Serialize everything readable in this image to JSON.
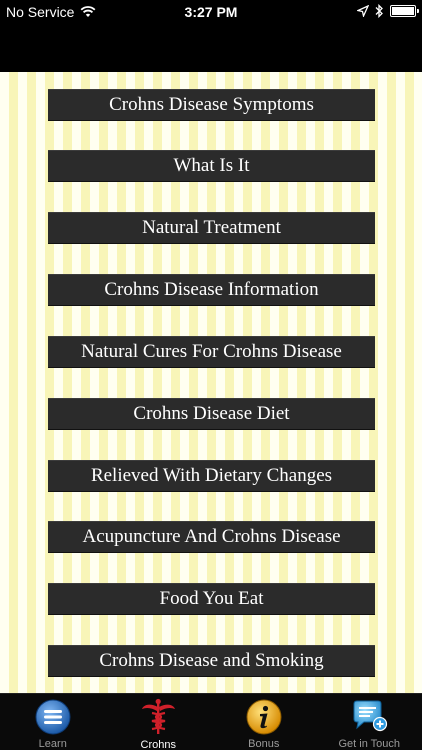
{
  "status_bar": {
    "carrier": "No Service",
    "time": "3:27 PM",
    "icons": [
      "wifi-icon",
      "location-arrow-icon",
      "bluetooth-icon",
      "battery-icon"
    ]
  },
  "menu": {
    "items": [
      "Crohns Disease Symptoms",
      "What Is It",
      "Natural Treatment",
      "Crohns Disease Information",
      "Natural Cures For Crohns Disease",
      "Crohns Disease Diet",
      "Relieved With Dietary Changes",
      "Acupuncture And Crohns Disease",
      "Food You Eat",
      "Crohns Disease and Smoking"
    ]
  },
  "tab_bar": {
    "active": "Crohns",
    "tabs": [
      {
        "label": "Learn",
        "icon": "list-menu-icon"
      },
      {
        "label": "Crohns",
        "icon": "caduceus-icon"
      },
      {
        "label": "Bonus",
        "icon": "info-icon"
      },
      {
        "label": "Get in Touch",
        "icon": "chat-add-icon"
      }
    ]
  },
  "colors": {
    "button_bg": "#2b2b2b",
    "stripe_light": "#fffff0",
    "stripe_yellow": "#f8f5b8",
    "active_tab_icon": "#d0202a",
    "learn_icon": "#2f74c8",
    "bonus_icon": "#f2b21a",
    "touch_icon": "#3aa4e0"
  }
}
